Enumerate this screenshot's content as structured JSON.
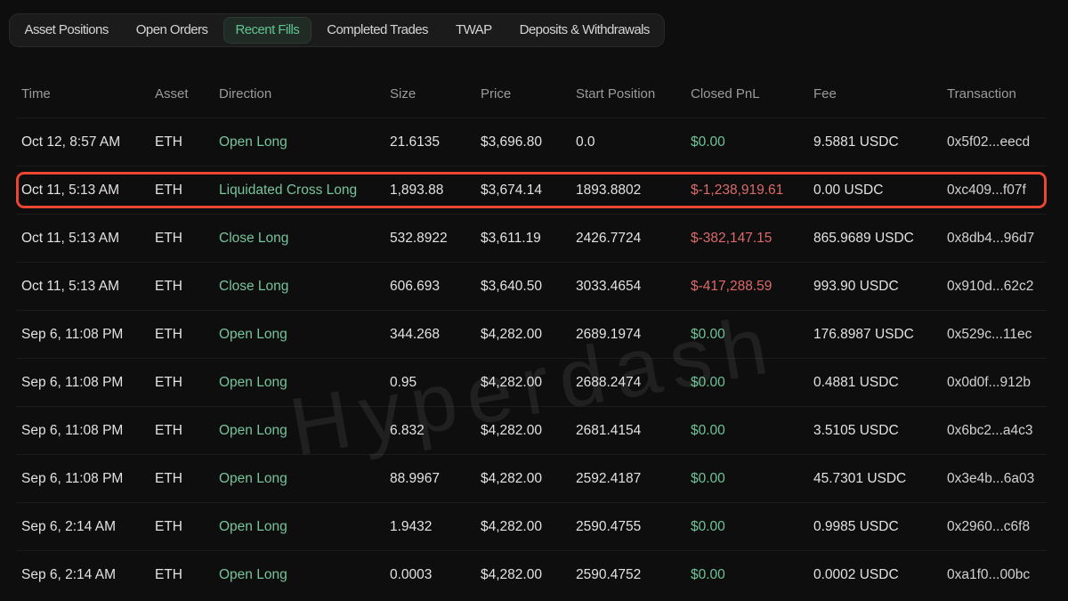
{
  "watermark": {
    "text": "Hyperdash"
  },
  "tabs": {
    "items": [
      {
        "label": "Asset Positions",
        "active": false
      },
      {
        "label": "Open Orders",
        "active": false
      },
      {
        "label": "Recent Fills",
        "active": true
      },
      {
        "label": "Completed Trades",
        "active": false
      },
      {
        "label": "TWAP",
        "active": false
      },
      {
        "label": "Deposits & Withdrawals",
        "active": false
      }
    ]
  },
  "colors": {
    "background": "#0d0e0d",
    "accent_green": "#5fc48f",
    "positive_green": "#6fc39a",
    "negative_red": "#dc696c",
    "highlight_border_red": "#ec4633"
  },
  "table": {
    "columns": [
      "Time",
      "Asset",
      "Direction",
      "Size",
      "Price",
      "Start Position",
      "Closed PnL",
      "Fee",
      "Transaction"
    ],
    "rows": [
      {
        "time": "Oct 12, 8:57 AM",
        "asset": "ETH",
        "direction": "Open Long",
        "size": "21.6135",
        "price": "$3,696.80",
        "start_position": "0.0",
        "closed_pnl": "$0.00",
        "pnl_kind": "positive",
        "fee": "9.5881 USDC",
        "transaction": "0x5f02...eecd",
        "highlighted": false
      },
      {
        "time": "Oct 11, 5:13 AM",
        "asset": "ETH",
        "direction": "Liquidated Cross Long",
        "size": "1,893.88",
        "price": "$3,674.14",
        "start_position": "1893.8802",
        "closed_pnl": "$-1,238,919.61",
        "pnl_kind": "negative",
        "fee": "0.00 USDC",
        "transaction": "0xc409...f07f",
        "highlighted": true
      },
      {
        "time": "Oct 11, 5:13 AM",
        "asset": "ETH",
        "direction": "Close Long",
        "size": "532.8922",
        "price": "$3,611.19",
        "start_position": "2426.7724",
        "closed_pnl": "$-382,147.15",
        "pnl_kind": "negative",
        "fee": "865.9689 USDC",
        "transaction": "0x8db4...96d7",
        "highlighted": false
      },
      {
        "time": "Oct 11, 5:13 AM",
        "asset": "ETH",
        "direction": "Close Long",
        "size": "606.693",
        "price": "$3,640.50",
        "start_position": "3033.4654",
        "closed_pnl": "$-417,288.59",
        "pnl_kind": "negative",
        "fee": "993.90 USDC",
        "transaction": "0x910d...62c2",
        "highlighted": false
      },
      {
        "time": "Sep 6, 11:08 PM",
        "asset": "ETH",
        "direction": "Open Long",
        "size": "344.268",
        "price": "$4,282.00",
        "start_position": "2689.1974",
        "closed_pnl": "$0.00",
        "pnl_kind": "positive",
        "fee": "176.8987 USDC",
        "transaction": "0x529c...11ec",
        "highlighted": false
      },
      {
        "time": "Sep 6, 11:08 PM",
        "asset": "ETH",
        "direction": "Open Long",
        "size": "0.95",
        "price": "$4,282.00",
        "start_position": "2688.2474",
        "closed_pnl": "$0.00",
        "pnl_kind": "positive",
        "fee": "0.4881 USDC",
        "transaction": "0x0d0f...912b",
        "highlighted": false
      },
      {
        "time": "Sep 6, 11:08 PM",
        "asset": "ETH",
        "direction": "Open Long",
        "size": "6.832",
        "price": "$4,282.00",
        "start_position": "2681.4154",
        "closed_pnl": "$0.00",
        "pnl_kind": "positive",
        "fee": "3.5105 USDC",
        "transaction": "0x6bc2...a4c3",
        "highlighted": false
      },
      {
        "time": "Sep 6, 11:08 PM",
        "asset": "ETH",
        "direction": "Open Long",
        "size": "88.9967",
        "price": "$4,282.00",
        "start_position": "2592.4187",
        "closed_pnl": "$0.00",
        "pnl_kind": "positive",
        "fee": "45.7301 USDC",
        "transaction": "0x3e4b...6a03",
        "highlighted": false
      },
      {
        "time": "Sep 6, 2:14 AM",
        "asset": "ETH",
        "direction": "Open Long",
        "size": "1.9432",
        "price": "$4,282.00",
        "start_position": "2590.4755",
        "closed_pnl": "$0.00",
        "pnl_kind": "positive",
        "fee": "0.9985 USDC",
        "transaction": "0x2960...c6f8",
        "highlighted": false
      },
      {
        "time": "Sep 6, 2:14 AM",
        "asset": "ETH",
        "direction": "Open Long",
        "size": "0.0003",
        "price": "$4,282.00",
        "start_position": "2590.4752",
        "closed_pnl": "$0.00",
        "pnl_kind": "positive",
        "fee": "0.0002 USDC",
        "transaction": "0xa1f0...00bc",
        "highlighted": false
      }
    ]
  }
}
